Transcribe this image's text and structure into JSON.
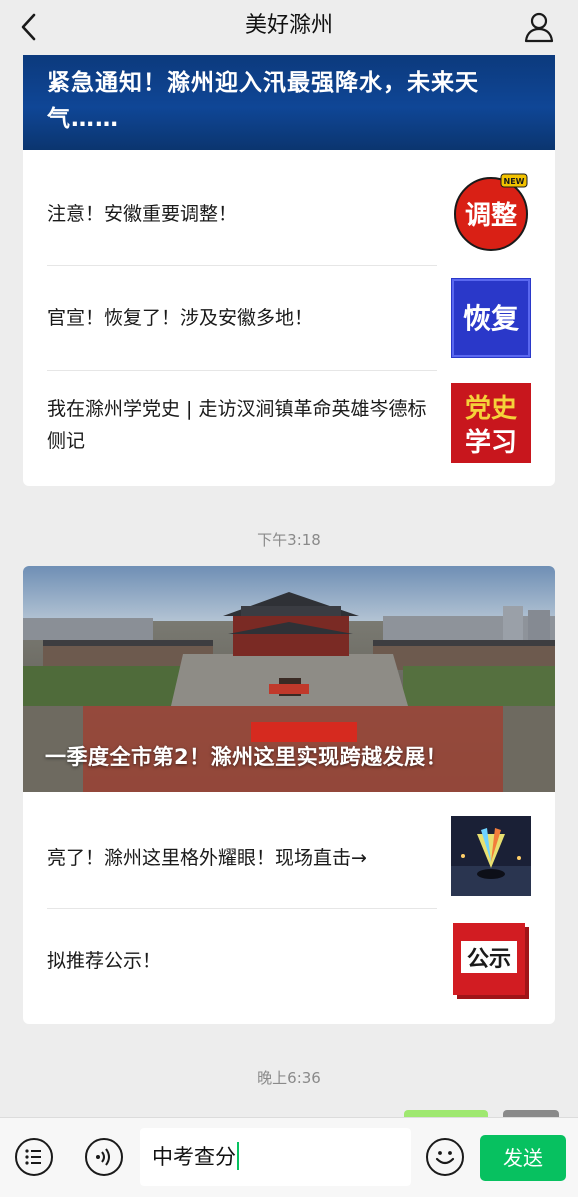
{
  "header": {
    "title": "美好滁州"
  },
  "card1": {
    "hero_title": "紧急通知！滁州迎入汛最强降水，未来天气……",
    "items": [
      {
        "text": "注意！安徽重要调整！",
        "thumb_label": "调整",
        "thumb_badge": "NEW"
      },
      {
        "text": "官宣！恢复了！涉及安徽多地！",
        "thumb_label": "恢复"
      },
      {
        "text": "我在滁州学党史 | 走访汊涧镇革命英雄岑德标侧记",
        "thumb_label_1": "党史",
        "thumb_label_2": "学习"
      }
    ]
  },
  "timestamps": {
    "first": "下午3:18",
    "second": "晚上6:36"
  },
  "card2": {
    "hero_title": "一季度全市第2！滁州这里实现跨越发展！",
    "items": [
      {
        "text": "亮了！滁州这里格外耀眼！现场直击→"
      },
      {
        "text": "拟推荐公示！",
        "thumb_label": "公示"
      }
    ]
  },
  "input": {
    "value": "中考查分",
    "send_label": "发送"
  },
  "colors": {
    "accent_green": "#07c160",
    "hero_blue": "#0f4696",
    "thumb_red": "#c8161d"
  },
  "icons": [
    "back-chevron-icon",
    "profile-icon",
    "menu-list-icon",
    "voice-icon",
    "emoji-icon"
  ]
}
